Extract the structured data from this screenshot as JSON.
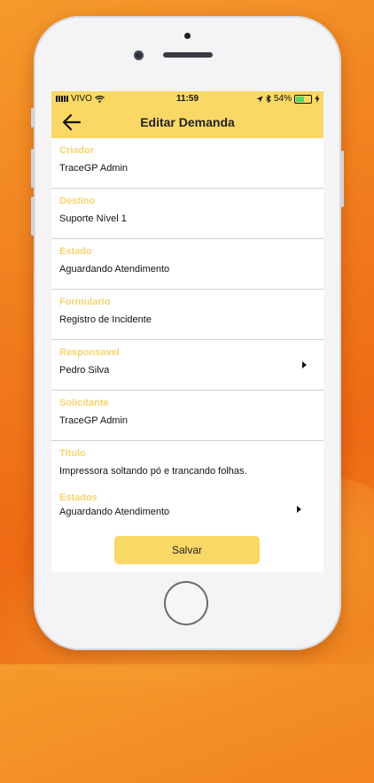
{
  "status": {
    "carrier": "VIVO",
    "time": "11:59",
    "battery": "54%",
    "battery_level": 0.54
  },
  "header": {
    "title": "Editar Demanda",
    "back_icon": "arrow-left-icon"
  },
  "fields": [
    {
      "label": "Criador",
      "value": "TraceGP Admin",
      "has_arrow": false
    },
    {
      "label": "Destino",
      "value": "Suporte Nível 1",
      "has_arrow": false
    },
    {
      "label": "Estado",
      "value": "Aguardando Atendimento",
      "has_arrow": false
    },
    {
      "label": "Formulario",
      "value": "Registro de Incidente",
      "has_arrow": false
    },
    {
      "label": "Responsavel",
      "value": "Pedro Silva",
      "has_arrow": true
    },
    {
      "label": "Solicitante",
      "value": "TraceGP Admin",
      "has_arrow": false
    },
    {
      "label": "Titulo",
      "value": "Impressora soltando pó e trancando folhas.",
      "has_arrow": false
    },
    {
      "label": "Estados",
      "value": "Aguardando Atendimento",
      "has_arrow": true
    }
  ],
  "save_label": "Salvar",
  "colors": {
    "accent": "#f9d865",
    "label": "#f6d46e",
    "background": "#f07a1c"
  }
}
